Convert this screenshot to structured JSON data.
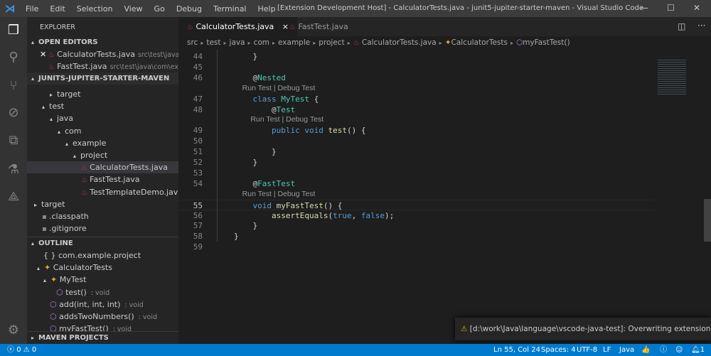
{
  "titlebar": {
    "menus": [
      "File",
      "Edit",
      "Selection",
      "View",
      "Go",
      "Debug",
      "Terminal",
      "Help"
    ],
    "title": "[Extension Development Host] - CalculatorTests.java - junit5-jupiter-starter-maven - Visual Studio Code"
  },
  "sidebar": {
    "title": "EXPLORER",
    "open_editors_header": "OPEN EDITORS",
    "open_editors": [
      {
        "name": "CalculatorTests.java",
        "path": "src\\test\\java\\co..."
      },
      {
        "name": "FastTest.java",
        "path": "src\\test\\java\\com\\examp..."
      }
    ],
    "project_header": "JUNITS-JUPITER-STARTER-MAVEN",
    "tree": [
      {
        "label": "target",
        "depth": 2,
        "twisty": "▸"
      },
      {
        "label": "test",
        "depth": 1,
        "twisty": "▴"
      },
      {
        "label": "java",
        "depth": 2,
        "twisty": "▴"
      },
      {
        "label": "com",
        "depth": 3,
        "twisty": "▴"
      },
      {
        "label": "example",
        "depth": 4,
        "twisty": "▴"
      },
      {
        "label": "project",
        "depth": 5,
        "twisty": "▴"
      },
      {
        "label": "CalculatorTests.java",
        "depth": 6,
        "file": true,
        "selected": true
      },
      {
        "label": "FastTest.java",
        "depth": 6,
        "file": true
      },
      {
        "label": "TestTemplateDemo.java",
        "depth": 6,
        "file": true
      },
      {
        "label": "target",
        "depth": 0,
        "twisty": "▸"
      },
      {
        "label": ".classpath",
        "depth": 1,
        "file": true
      },
      {
        "label": ".gitignore",
        "depth": 1,
        "file": true
      }
    ],
    "outline_header": "OUTLINE",
    "outline": [
      {
        "label": "com.example.project",
        "icon": "{ }",
        "depth": 1
      },
      {
        "label": "CalculatorTests",
        "icon": "class",
        "depth": 0,
        "twisty": "▴"
      },
      {
        "label": "MyTest",
        "icon": "class",
        "depth": 1,
        "twisty": "▴"
      },
      {
        "label": "test()",
        "type": ": void",
        "icon": "method",
        "depth": 3
      },
      {
        "label": "add(int, int, int)",
        "type": ": void",
        "icon": "method",
        "depth": 2
      },
      {
        "label": "addsTwoNumbers()",
        "type": ": void",
        "icon": "method",
        "depth": 2
      },
      {
        "label": "myFastTest()",
        "type": ": void",
        "icon": "method",
        "depth": 2
      }
    ],
    "maven_header": "MAVEN PROJECTS"
  },
  "tabs": [
    {
      "label": "CalculatorTests.java",
      "active": true,
      "close": "×"
    },
    {
      "label": "FastTest.java",
      "active": false
    }
  ],
  "breadcrumb": [
    "src",
    "test",
    "java",
    "com",
    "example",
    "project",
    "CalculatorTests.java",
    "CalculatorTests",
    "myFastTest()"
  ],
  "code": [
    {
      "n": "44",
      "tokens": [
        [
          "    }",
          "p"
        ]
      ]
    },
    {
      "n": "45",
      "tokens": []
    },
    {
      "n": "46",
      "tokens": [
        [
          "    @",
          "p"
        ],
        [
          "Nested",
          "an"
        ]
      ]
    },
    {
      "lens": "    Run Test | Debug Test"
    },
    {
      "n": "47",
      "tokens": [
        [
          "    class ",
          "k"
        ],
        [
          "MyTest",
          "t"
        ],
        [
          " {",
          "p"
        ]
      ]
    },
    {
      "n": "48",
      "tokens": [
        [
          "        @",
          "p"
        ],
        [
          "Test",
          "an"
        ]
      ]
    },
    {
      "lens": "        Run Test | Debug Test"
    },
    {
      "n": "49",
      "tokens": [
        [
          "        public void ",
          "k"
        ],
        [
          "test",
          "f"
        ],
        [
          "() {",
          "p"
        ]
      ]
    },
    {
      "n": "50",
      "tokens": []
    },
    {
      "n": "51",
      "tokens": [
        [
          "        }",
          "p"
        ]
      ]
    },
    {
      "n": "52",
      "tokens": [
        [
          "    }",
          "p"
        ]
      ]
    },
    {
      "n": "53",
      "tokens": []
    },
    {
      "n": "54",
      "tokens": [
        [
          "    @",
          "p"
        ],
        [
          "FastTest",
          "an"
        ]
      ]
    },
    {
      "lens": "    Run Test | Debug Test"
    },
    {
      "n": "55",
      "current": true,
      "tokens": [
        [
          "    void ",
          "k"
        ],
        [
          "myFastTest",
          "f"
        ],
        [
          "() {",
          "p"
        ]
      ]
    },
    {
      "n": "56",
      "tokens": [
        [
          "        ",
          "p"
        ],
        [
          "assertEquals",
          "f"
        ],
        [
          "(",
          "p"
        ],
        [
          "true",
          "k"
        ],
        [
          ", ",
          "p"
        ],
        [
          "false",
          "k"
        ],
        [
          ");",
          "p"
        ]
      ]
    },
    {
      "n": "57",
      "tokens": [
        [
          "    }",
          "p"
        ]
      ]
    },
    {
      "n": "58",
      "tokens": [
        [
          "}",
          "p"
        ]
      ]
    },
    {
      "n": "59",
      "tokens": []
    }
  ],
  "notification": {
    "icon": "warning-icon",
    "text": "[d:\\work\\Java\\language\\vscode-java-test]: Overwriting extension c:\\Us..."
  },
  "status": {
    "errors": "0",
    "warnings": "0",
    "position": "Ln 55, Col 24",
    "spaces": "Spaces: 4",
    "encoding": "UTF-8",
    "eol": "LF",
    "language": "Java",
    "notifications": "1"
  },
  "colors": {
    "accent": "#007acc",
    "editor_bg": "#1e1e1e",
    "sidebar_bg": "#252526"
  }
}
